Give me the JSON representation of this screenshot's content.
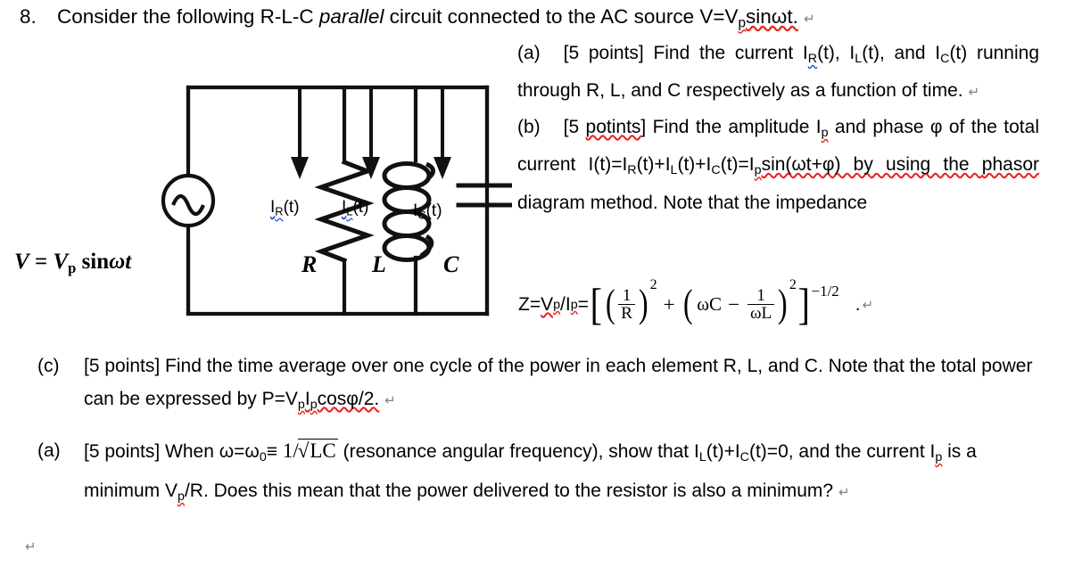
{
  "question": {
    "number": "8.",
    "stem_part1": "Consider the following R-L-C ",
    "stem_italic": "parallel",
    "stem_part2": " circuit connected to the AC source V=V",
    "stem_sub": "p",
    "stem_part3": "sinωt.",
    "pilcrow": "↵"
  },
  "part_a": {
    "tag": "(a)",
    "text1": "[5 points] Find the current I",
    "sub1": "R",
    "text2": "(t), I",
    "sub2": "L",
    "text3": "(t), and I",
    "sub3": "C",
    "text4": "(t) running through R, L, and C respectively as a function of time.",
    "pilcrow": "↵"
  },
  "part_b": {
    "tag": "(b)",
    "text1": "[5 ",
    "typo": "potints",
    "text2": "] Find the amplitude I",
    "sub1": "p",
    "text3": " and phase φ of the total current I(t)=I",
    "sub2": "R",
    "text4": "(t)+I",
    "sub3": "L",
    "text5": "(t)+I",
    "sub4": "C",
    "text6": "(t)=I",
    "sub5": "p",
    "text7": "sin(ωt+φ) by using the ",
    "word_phasor": "phasor",
    "text8": " diagram method.  Note  that  the  impedance"
  },
  "impedance": {
    "lead_z": "Z=",
    "lead_v": "V",
    "lead_v_sub": "p",
    "slash": "/I",
    "lead_i_sub": "p",
    "equals": "=",
    "bracket_open": "[",
    "paren_open1": "(",
    "frac1_num": "1",
    "frac1_den": "R",
    "paren_close1": ")",
    "exp1": "2",
    "plus": "+",
    "paren_open2": "(",
    "omega_c": "ωC",
    "minus": "−",
    "frac2_num": "1",
    "frac2_den": "ωL",
    "paren_close2": ")",
    "exp2": "2",
    "bracket_close": "]",
    "exp_outer": "−1/2",
    "period": ".",
    "pilcrow": "↵"
  },
  "part_c": {
    "tag": "(c)",
    "text1": "[5 points] Find the time average over one cycle of the power in each element R, L, and C. Note that the total power can be expressed by P=V",
    "sub1": "p",
    "text2": "I",
    "sub2": "p",
    "text3": "cosφ/2.",
    "pilcrow": "↵"
  },
  "part_d": {
    "tag": "(a)",
    "text1": "[5 points] When ω=ω",
    "sub1": "0",
    "text2": "≡ ",
    "formula": "1/√LC",
    "text3": " (resonance angular frequency), show that I",
    "sub2": "L",
    "text4": "(t)+I",
    "sub3": "C",
    "text5": "(t)=0, and the current I",
    "sub4": "p",
    "text6": " is a minimum V",
    "sub5": "p",
    "text7": "/R. Does this mean that the power delivered to the resistor is also a minimum?",
    "pilcrow": "↵"
  },
  "circuit": {
    "source_label_v": "V",
    "source_label_eq": " = ",
    "source_label_vp": "V",
    "source_label_psub": "p",
    "source_label_sin": " sin",
    "source_label_wt": "ωt",
    "source_symbol": "ac-source-sine",
    "current_r": {
      "pre": "I",
      "sub": "R",
      "post": "(t)"
    },
    "current_l": {
      "pre": "I",
      "sub": "L",
      "post": "(t)"
    },
    "current_c": {
      "pre": "I",
      "sub": "C",
      "post": "(t)"
    },
    "component_r": "R",
    "component_l": "L",
    "component_c": "C"
  },
  "colors": {
    "ink": "#000000",
    "spell_red": "#e8251f",
    "grammar_blue": "#2a4fd6",
    "pilcrow_gray": "#808080"
  }
}
